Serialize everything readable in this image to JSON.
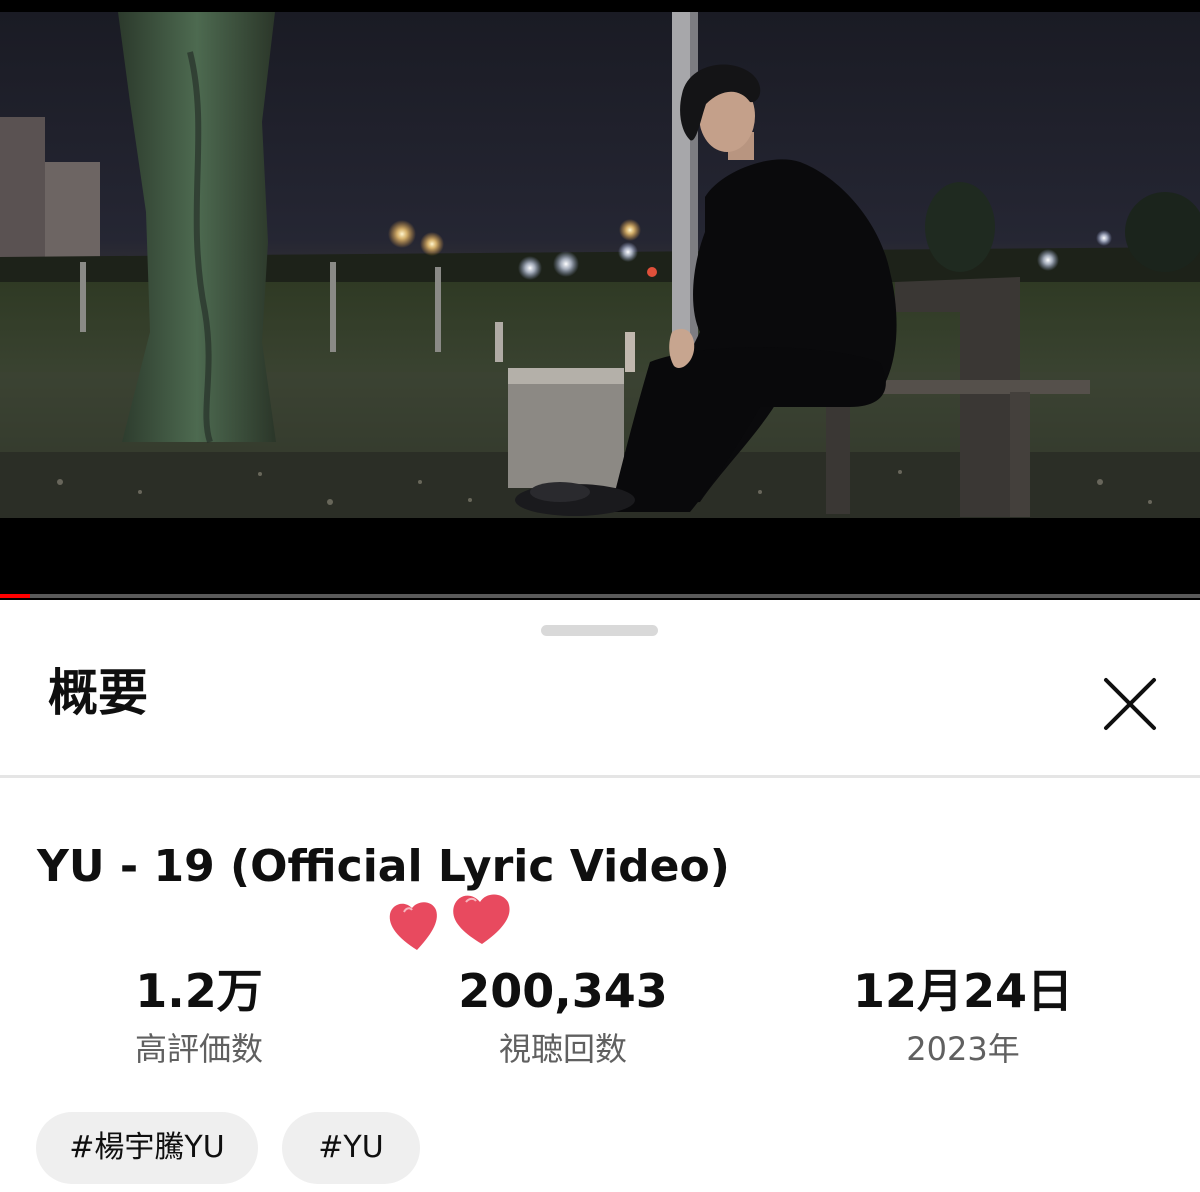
{
  "player": {
    "progress_fraction": 0.025,
    "accent_color": "#ff0000"
  },
  "sheet": {
    "title": "概要",
    "close_icon": "close-icon"
  },
  "video": {
    "title": "YU - 19 (Official Lyric Video)"
  },
  "stats": [
    {
      "value": "1.2万",
      "label": "高評価数"
    },
    {
      "value": "200,343",
      "label": "視聴回数"
    },
    {
      "value": "12月24日",
      "label": "2023年"
    }
  ],
  "tags": [
    "#楊宇騰YU",
    "#YU"
  ],
  "decoration": {
    "icon": "hearts-sticker",
    "color": "#e84a5f"
  }
}
